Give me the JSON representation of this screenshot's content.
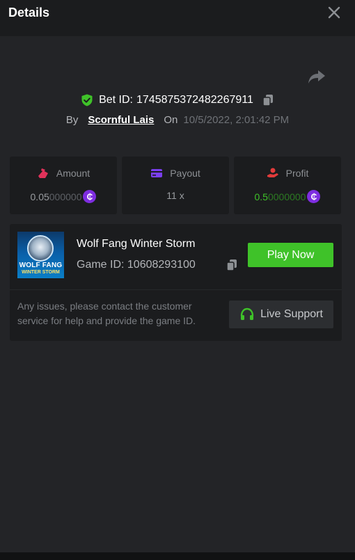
{
  "header": {
    "title": "Details",
    "close_icon": "close-icon"
  },
  "bet": {
    "label": "Bet ID:",
    "id": "1745875372482267911",
    "by_label": "By",
    "user": "Scornful Lais",
    "on_label": "On",
    "date": "10/5/2022, 2:01:42 PM"
  },
  "stats": {
    "amount": {
      "label": "Amount",
      "value_main": "0.05",
      "value_rest": "000000",
      "icon": "money-bag-icon"
    },
    "payout": {
      "label": "Payout",
      "value": "11 x",
      "icon": "card-icon"
    },
    "profit": {
      "label": "Profit",
      "value_main": "0.5",
      "value_rest": "0000000",
      "icon": "hand-coin-icon"
    }
  },
  "currency_symbol": "₵",
  "game": {
    "thumb_title": "WOLF FANG",
    "thumb_subtitle": "WINTER STORM",
    "name": "Wolf Fang Winter Storm",
    "id_text": "Game ID: 10608293100",
    "play_label": "Play Now",
    "issue_text": "Any issues, please contact the customer service for help and provide the game ID.",
    "support_label": "Live Support"
  },
  "colors": {
    "accent_green": "#3fc229",
    "coin_purple": "#7e2de0",
    "amount_icon": "#e0325a",
    "payout_icon": "#7b3ff0",
    "profit_icon": "#e23b3b"
  }
}
